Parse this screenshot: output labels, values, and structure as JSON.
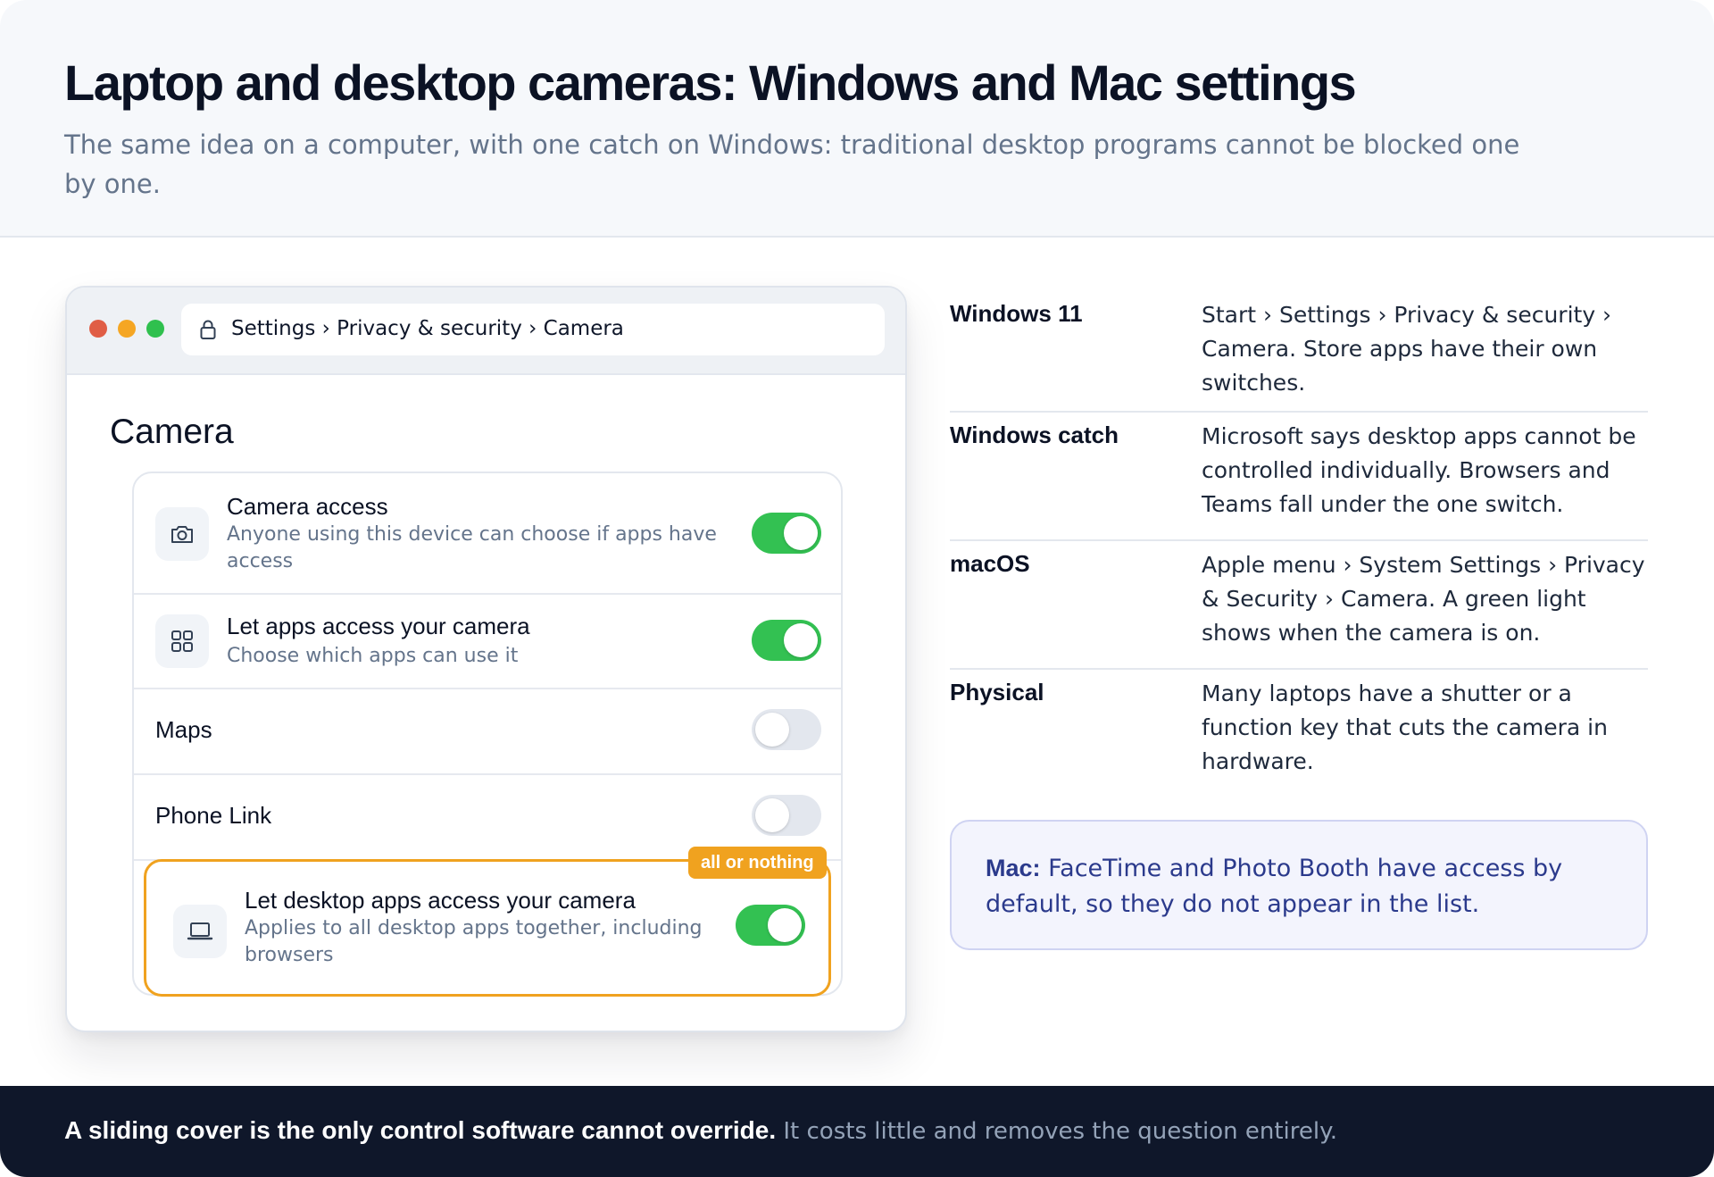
{
  "header": {
    "title": "Laptop and desktop cameras: Windows and Mac settings",
    "subtitle": "The same idea on a computer, with one catch on Windows: traditional desktop programs cannot be blocked one by one."
  },
  "window": {
    "address": "Settings › Privacy & security › Camera",
    "section_title": "Camera",
    "rows": [
      {
        "title": "Camera access",
        "desc": "Anyone using this device can choose if apps have access",
        "icon": "camera-icon",
        "state": "on"
      },
      {
        "title": "Let apps access your camera",
        "desc": "Choose which apps can use it",
        "icon": "apps-grid-icon",
        "state": "on"
      },
      {
        "title": "Maps",
        "state": "off"
      },
      {
        "title": "Phone Link",
        "state": "off"
      }
    ],
    "highlight": {
      "badge": "all or nothing",
      "title": "Let desktop apps access your camera",
      "desc": "Applies to all desktop apps together, including browsers",
      "icon": "laptop-icon",
      "state": "on"
    }
  },
  "info": [
    {
      "label": "Windows 11",
      "value": "Start › Settings › Privacy & security › Camera. Store apps have their own switches."
    },
    {
      "label": "Windows catch",
      "value": "Microsoft says desktop apps cannot be controlled individually. Browsers and Teams fall under the one switch."
    },
    {
      "label": "macOS",
      "value": "Apple menu › System Settings › Privacy & Security › Camera. A green light shows when the camera is on."
    },
    {
      "label": "Physical",
      "value": "Many laptops have a shutter or a function key that cuts the camera in hardware."
    }
  ],
  "note": {
    "bold": "Mac:",
    "text": " FaceTime and Photo Booth have access by default, so they do not appear in the list."
  },
  "footer": {
    "bold": "A sliding cover is the only control software cannot override.",
    "text": " It costs little and removes the question entirely."
  },
  "colors": {
    "toggle_on": "#33c152",
    "toggle_off": "#e3e7ee",
    "highlight": "#f0a21f",
    "note_text": "#2b3a8c",
    "footer_bg": "#0f172a"
  }
}
